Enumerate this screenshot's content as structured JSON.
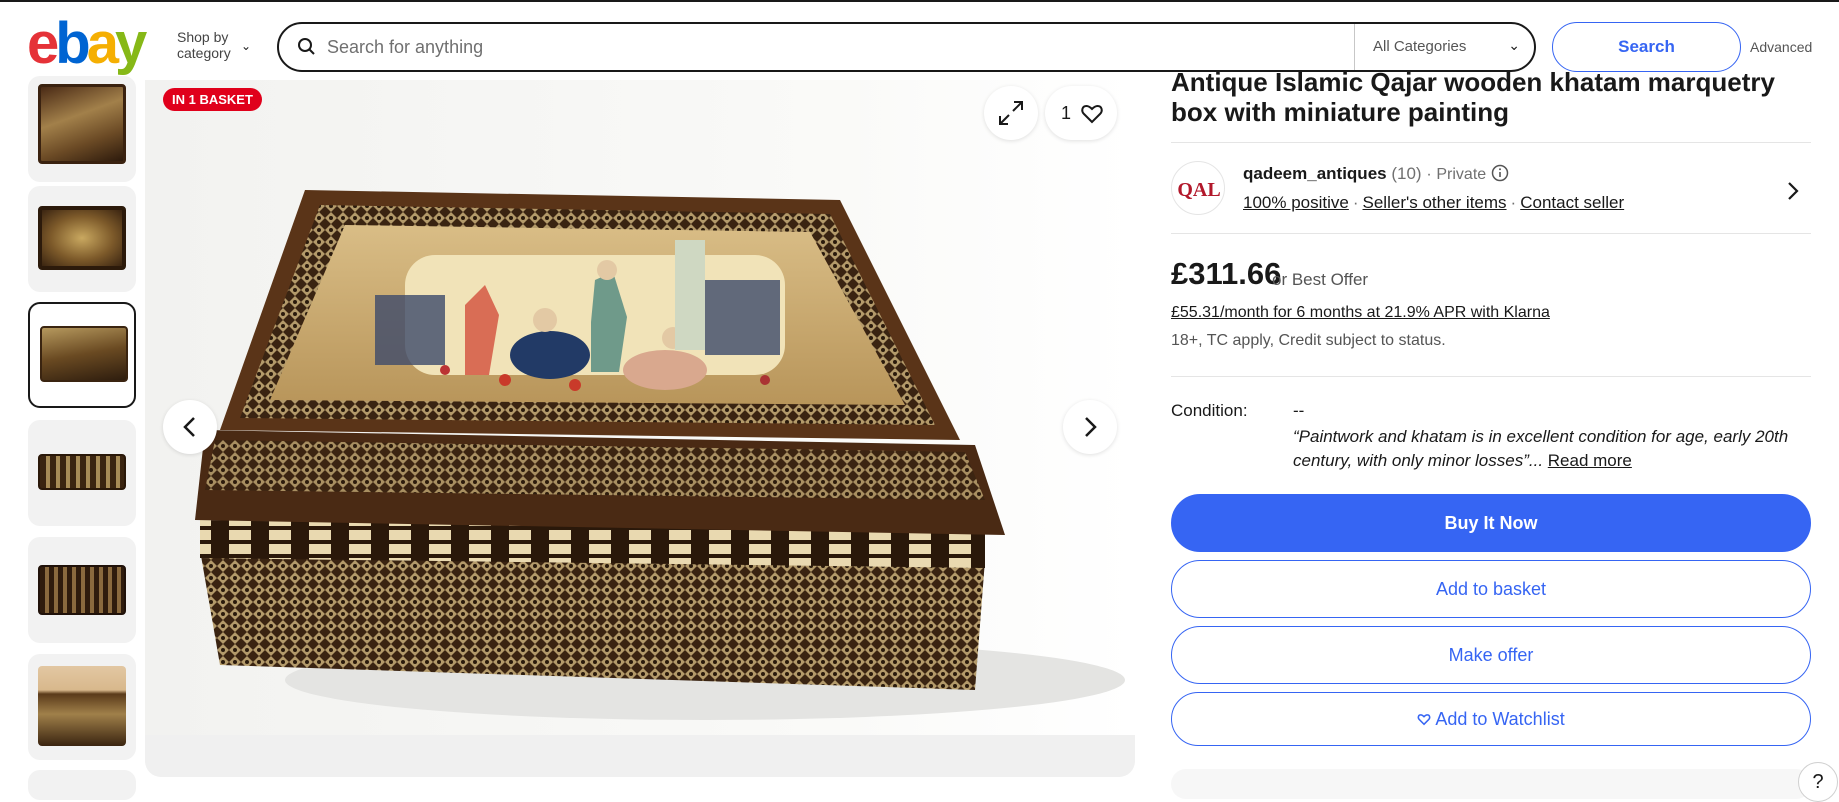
{
  "header": {
    "logo_letters": [
      "e",
      "b",
      "a",
      "y"
    ],
    "logo_colors": [
      "#e53238",
      "#0064d2",
      "#f5af02",
      "#86b817"
    ],
    "shop_by_category": [
      "Shop by",
      "category"
    ],
    "search_placeholder": "Search for anything",
    "category_select": "All Categories",
    "search_button": "Search",
    "advanced_link": "Advanced"
  },
  "gallery": {
    "badge": "IN 1 BASKET",
    "watch_count": "1",
    "selected_thumbnail": 3,
    "thumbnail_count_visible": 7
  },
  "listing": {
    "title": "Antique Islamic Qajar wooden khatam marquetry box with miniature painting",
    "seller": {
      "logo_text": "QAL",
      "name": "qadeem_antiques",
      "feedback": "(10)",
      "separator": "·",
      "type": "Private",
      "positive": "100% positive",
      "other_items": "Seller's other items",
      "contact": "Contact seller"
    },
    "price": "£311.66",
    "best_offer": "or Best Offer",
    "klarna": "£55.31/month for 6 months at 21.9% APR with Klarna",
    "terms": "18+, TC apply, Credit subject to status.",
    "condition_label": "Condition:",
    "condition_value": "--",
    "condition_desc": "“Paintwork and khatam is in excellent condition for age, early 20th century, with only minor losses”...",
    "read_more": "Read more",
    "buttons": {
      "buy_now": "Buy It Now",
      "add_basket": "Add to basket",
      "make_offer": "Make offer",
      "watchlist": "Add to Watchlist"
    },
    "help": "?"
  }
}
